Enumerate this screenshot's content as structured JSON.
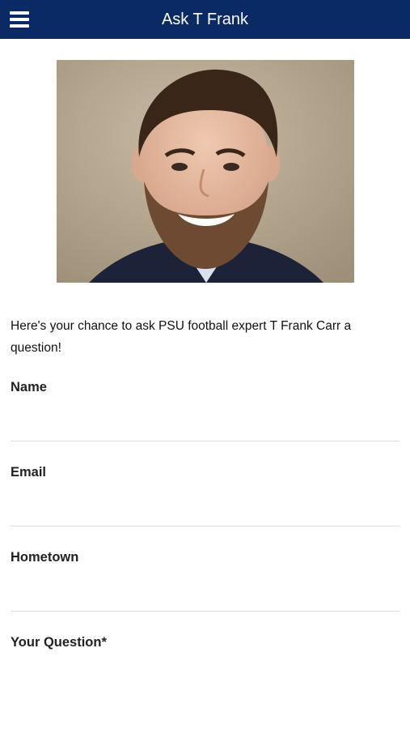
{
  "header": {
    "title": "Ask T Frank",
    "menu_icon": "hamburger-menu-icon",
    "background_color": "#0a2a66"
  },
  "intro_text": "Here's your chance to ask PSU football expert T Frank Carr a question!",
  "form": {
    "name": {
      "label": "Name",
      "value": ""
    },
    "email": {
      "label": "Email",
      "value": ""
    },
    "hometown": {
      "label": "Hometown",
      "value": ""
    },
    "question": {
      "label": "Your Question*",
      "value": ""
    }
  }
}
